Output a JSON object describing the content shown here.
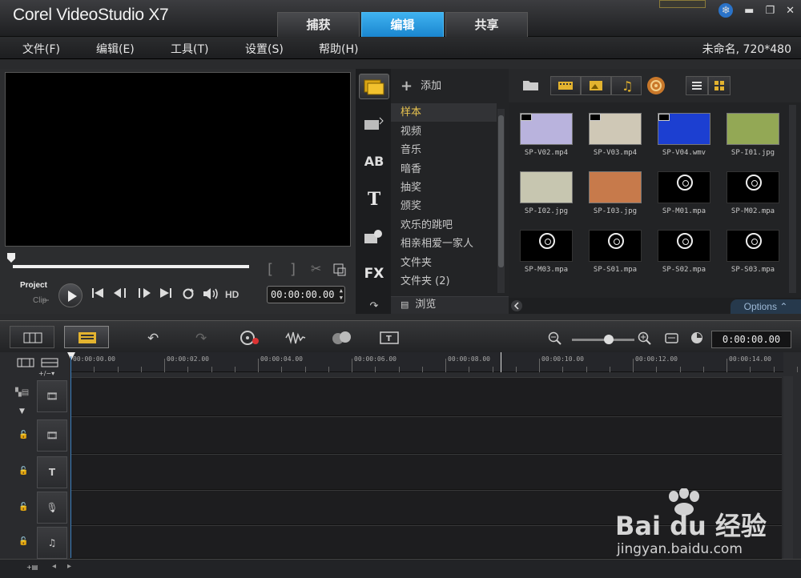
{
  "app": {
    "title": "Corel VideoStudio X7"
  },
  "modes": [
    {
      "label": "捕获",
      "active": false
    },
    {
      "label": "编辑",
      "active": true
    },
    {
      "label": "共享",
      "active": false
    }
  ],
  "menu": [
    "文件(F)",
    "编辑(E)",
    "工具(T)",
    "设置(S)",
    "帮助(H)"
  ],
  "project_info": "未命名, 720*480",
  "player": {
    "project_label": "Project",
    "clip_label": "Clip",
    "hd_label": "HD",
    "timecode": "00:00:00.00",
    "scrub_fraction": 0
  },
  "library": {
    "add_label": "添加",
    "folders": [
      "样本",
      "视频",
      "音乐",
      "暗香",
      "抽奖",
      "颁奖",
      "欢乐的跳吧",
      "相亲相爱一家人",
      "文件夹",
      "文件夹 (2)"
    ],
    "selected_folder": "样本",
    "browse_label": "浏览",
    "options_label": "Options",
    "thumbnails": [
      {
        "name": "SP-V02.mp4",
        "kind": "video",
        "color": "#b9b3dd"
      },
      {
        "name": "SP-V03.mp4",
        "kind": "video",
        "color": "#cfc8b6"
      },
      {
        "name": "SP-V04.wmv",
        "kind": "video",
        "color": "#1c3fd1"
      },
      {
        "name": "SP-I01.jpg",
        "kind": "image",
        "color": "#93a855"
      },
      {
        "name": "SP-I02.jpg",
        "kind": "image",
        "color": "#c7c6b0"
      },
      {
        "name": "SP-I03.jpg",
        "kind": "image",
        "color": "#c77a4b"
      },
      {
        "name": "SP-M01.mpa",
        "kind": "audio",
        "color": "#000000"
      },
      {
        "name": "SP-M02.mpa",
        "kind": "audio",
        "color": "#000000"
      },
      {
        "name": "SP-M03.mpa",
        "kind": "audio",
        "color": "#000000"
      },
      {
        "name": "SP-S01.mpa",
        "kind": "audio",
        "color": "#000000"
      },
      {
        "name": "SP-S02.mpa",
        "kind": "audio",
        "color": "#000000"
      },
      {
        "name": "SP-S03.mpa",
        "kind": "audio",
        "color": "#000000"
      }
    ]
  },
  "timeline": {
    "timecode": "0:00:00.00",
    "ruler": [
      "00:00:00.00",
      "00:00:02.00",
      "00:00:04.00",
      "00:00:06.00",
      "00:00:08.00",
      "00:00:10.00",
      "00:00:12.00",
      "00:00:14.00"
    ],
    "track_count": 5
  },
  "colors": {
    "accent": "#1f95e0",
    "selected_folder": "#e8c34f"
  },
  "watermark": {
    "logo": "Bai du 经验",
    "url": "jingyan.baidu.com"
  }
}
